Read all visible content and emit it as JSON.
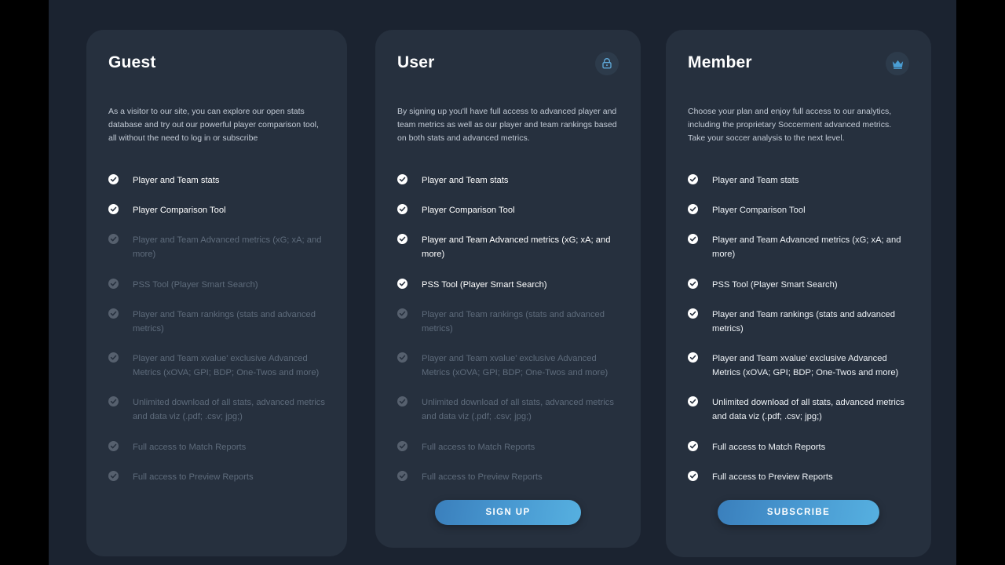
{
  "theme": {
    "page_background": "#1b2330",
    "card_background": "#26303e",
    "letterbox": "#000000",
    "accent_start": "#3a7fbc",
    "accent_end": "#56b0e0",
    "text_primary": "#ffffff",
    "text_muted": "#c3cbd6",
    "text_disabled": "#5e6b7b"
  },
  "plans": [
    {
      "id": "guest",
      "title": "Guest",
      "badge_icon": null,
      "description": "As a visitor to our site, you can explore our open stats database and try out our powerful player comparison tool, all without the need to log in or subscribe",
      "cta": null,
      "features": [
        {
          "label": "Player and Team stats",
          "enabled": true
        },
        {
          "label": "Player Comparison Tool",
          "enabled": true
        },
        {
          "label": "Player and Team Advanced metrics (xG; xA; and more)",
          "enabled": false
        },
        {
          "label": "PSS Tool (Player Smart Search)",
          "enabled": false
        },
        {
          "label": "Player and Team rankings (stats and advanced metrics)",
          "enabled": false
        },
        {
          "label": "Player and Team xvalue' exclusive Advanced Metrics (xOVA; GPI; BDP; One-Twos and more)",
          "enabled": false
        },
        {
          "label": "Unlimited download of all stats, advanced metrics and data viz (.pdf; .csv; jpg;)",
          "enabled": false
        },
        {
          "label": "Full access to Match Reports",
          "enabled": false
        },
        {
          "label": "Full access to Preview Reports",
          "enabled": false
        }
      ]
    },
    {
      "id": "user",
      "title": "User",
      "badge_icon": "lock-icon",
      "description": "By signing up you'll have full access to advanced player and team metrics as well as our player and team rankings based on both stats and advanced metrics.",
      "cta": "SIGN UP",
      "features": [
        {
          "label": "Player and Team stats",
          "enabled": true
        },
        {
          "label": "Player Comparison Tool",
          "enabled": true
        },
        {
          "label": "Player and Team Advanced metrics (xG; xA; and more)",
          "enabled": true
        },
        {
          "label": "PSS Tool (Player Smart Search)",
          "enabled": true
        },
        {
          "label": "Player and Team rankings (stats and advanced metrics)",
          "enabled": false
        },
        {
          "label": "Player and Team xvalue' exclusive Advanced Metrics (xOVA; GPI; BDP; One-Twos and more)",
          "enabled": false
        },
        {
          "label": "Unlimited download of all stats, advanced metrics and data viz (.pdf; .csv; jpg;)",
          "enabled": false
        },
        {
          "label": "Full access to Match Reports",
          "enabled": false
        },
        {
          "label": "Full access to Preview Reports",
          "enabled": false
        }
      ]
    },
    {
      "id": "member",
      "title": "Member",
      "badge_icon": "crown-icon",
      "description": "Choose your plan and enjoy full access to our analytics, including the proprietary Soccerment advanced metrics. Take your soccer analysis to the next level.",
      "cta": "SUBSCRIBE",
      "features": [
        {
          "label": "Player and Team stats",
          "enabled": true
        },
        {
          "label": "Player Comparison Tool",
          "enabled": true
        },
        {
          "label": "Player and Team Advanced metrics (xG; xA; and more)",
          "enabled": true
        },
        {
          "label": "PSS Tool (Player Smart Search)",
          "enabled": true
        },
        {
          "label": "Player and Team rankings (stats and advanced metrics)",
          "enabled": true
        },
        {
          "label": "Player and Team xvalue' exclusive Advanced Metrics (xOVA; GPI; BDP; One-Twos and more)",
          "enabled": true
        },
        {
          "label": "Unlimited download of all stats, advanced metrics and data viz (.pdf; .csv; jpg;)",
          "enabled": true
        },
        {
          "label": "Full access to Match Reports",
          "enabled": true
        },
        {
          "label": "Full access to Preview Reports",
          "enabled": true
        }
      ]
    }
  ]
}
